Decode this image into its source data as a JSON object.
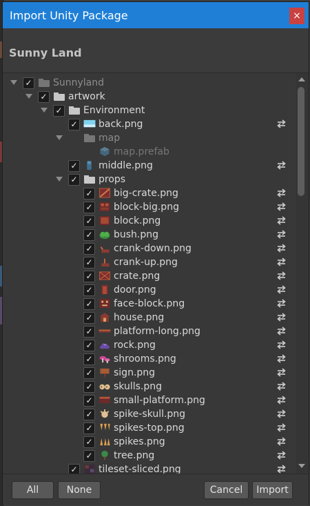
{
  "window": {
    "title": "Import Unity Package",
    "close_glyph": "×"
  },
  "package": {
    "name": "Sunny Land"
  },
  "tree": {
    "check_glyph": "✓",
    "items": [
      {
        "label": "Sunnyland",
        "kind": "folder",
        "depth": 0,
        "checked": true,
        "expanded": true,
        "dim": true,
        "refresh": false
      },
      {
        "label": "artwork",
        "kind": "folder",
        "depth": 1,
        "checked": true,
        "expanded": true,
        "dim": false,
        "refresh": false
      },
      {
        "label": "Environment",
        "kind": "folder",
        "depth": 2,
        "checked": true,
        "expanded": true,
        "dim": false,
        "refresh": false
      },
      {
        "label": "back.png",
        "kind": "image",
        "icon": "sky-image-icon",
        "depth": 3,
        "checked": true,
        "dim": false,
        "refresh": true
      },
      {
        "label": "map",
        "kind": "folder",
        "depth": 3,
        "checked": null,
        "expanded": true,
        "dim": true,
        "refresh": false
      },
      {
        "label": "map.prefab",
        "kind": "prefab",
        "icon": "prefab-cube-icon",
        "depth": 4,
        "checked": null,
        "dim": true,
        "refresh": false
      },
      {
        "label": "middle.png",
        "kind": "image",
        "icon": "middle-image-icon",
        "depth": 3,
        "checked": true,
        "dim": false,
        "refresh": true
      },
      {
        "label": "props",
        "kind": "folder",
        "depth": 3,
        "checked": true,
        "expanded": true,
        "dim": false,
        "refresh": false
      },
      {
        "label": "big-crate.png",
        "kind": "image",
        "icon": "big-crate-icon",
        "depth": 4,
        "checked": true,
        "dim": false,
        "refresh": true
      },
      {
        "label": "block-big.png",
        "kind": "image",
        "icon": "block-big-icon",
        "depth": 4,
        "checked": true,
        "dim": false,
        "refresh": true
      },
      {
        "label": "block.png",
        "kind": "image",
        "icon": "block-icon",
        "depth": 4,
        "checked": true,
        "dim": false,
        "refresh": true
      },
      {
        "label": "bush.png",
        "kind": "image",
        "icon": "bush-icon",
        "depth": 4,
        "checked": true,
        "dim": false,
        "refresh": true
      },
      {
        "label": "crank-down.png",
        "kind": "image",
        "icon": "crank-down-icon",
        "depth": 4,
        "checked": true,
        "dim": false,
        "refresh": true
      },
      {
        "label": "crank-up.png",
        "kind": "image",
        "icon": "crank-up-icon",
        "depth": 4,
        "checked": true,
        "dim": false,
        "refresh": true
      },
      {
        "label": "crate.png",
        "kind": "image",
        "icon": "crate-icon",
        "depth": 4,
        "checked": true,
        "dim": false,
        "refresh": true
      },
      {
        "label": "door.png",
        "kind": "image",
        "icon": "door-icon",
        "depth": 4,
        "checked": true,
        "dim": false,
        "refresh": true
      },
      {
        "label": "face-block.png",
        "kind": "image",
        "icon": "face-block-icon",
        "depth": 4,
        "checked": true,
        "dim": false,
        "refresh": true
      },
      {
        "label": "house.png",
        "kind": "image",
        "icon": "house-icon",
        "depth": 4,
        "checked": true,
        "dim": false,
        "refresh": true
      },
      {
        "label": "platform-long.png",
        "kind": "image",
        "icon": "platform-long-icon",
        "depth": 4,
        "checked": true,
        "dim": false,
        "refresh": true
      },
      {
        "label": "rock.png",
        "kind": "image",
        "icon": "rock-icon",
        "depth": 4,
        "checked": true,
        "dim": false,
        "refresh": true
      },
      {
        "label": "shrooms.png",
        "kind": "image",
        "icon": "shrooms-icon",
        "depth": 4,
        "checked": true,
        "dim": false,
        "refresh": true
      },
      {
        "label": "sign.png",
        "kind": "image",
        "icon": "sign-icon",
        "depth": 4,
        "checked": true,
        "dim": false,
        "refresh": true
      },
      {
        "label": "skulls.png",
        "kind": "image",
        "icon": "skulls-icon",
        "depth": 4,
        "checked": true,
        "dim": false,
        "refresh": true
      },
      {
        "label": "small-platform.png",
        "kind": "image",
        "icon": "small-platform-icon",
        "depth": 4,
        "checked": true,
        "dim": false,
        "refresh": true
      },
      {
        "label": "spike-skull.png",
        "kind": "image",
        "icon": "spike-skull-icon",
        "depth": 4,
        "checked": true,
        "dim": false,
        "refresh": true
      },
      {
        "label": "spikes-top.png",
        "kind": "image",
        "icon": "spikes-top-icon",
        "depth": 4,
        "checked": true,
        "dim": false,
        "refresh": true
      },
      {
        "label": "spikes.png",
        "kind": "image",
        "icon": "spikes-icon",
        "depth": 4,
        "checked": true,
        "dim": false,
        "refresh": true
      },
      {
        "label": "tree.png",
        "kind": "image",
        "icon": "tree-icon",
        "depth": 4,
        "checked": true,
        "dim": false,
        "refresh": true
      },
      {
        "label": "tileset-sliced.png",
        "kind": "image",
        "icon": "tileset-icon",
        "depth": 3,
        "checked": true,
        "dim": false,
        "refresh": true
      }
    ]
  },
  "footer": {
    "all_label": "All",
    "none_label": "None",
    "cancel_label": "Cancel",
    "import_label": "Import"
  },
  "colors": {
    "title_bar": "#1f7fd6",
    "close_button": "#c94242",
    "panel": "#383838",
    "text": "#d9d9d9",
    "text_dim": "#8d8d8d",
    "button": "#585858"
  }
}
